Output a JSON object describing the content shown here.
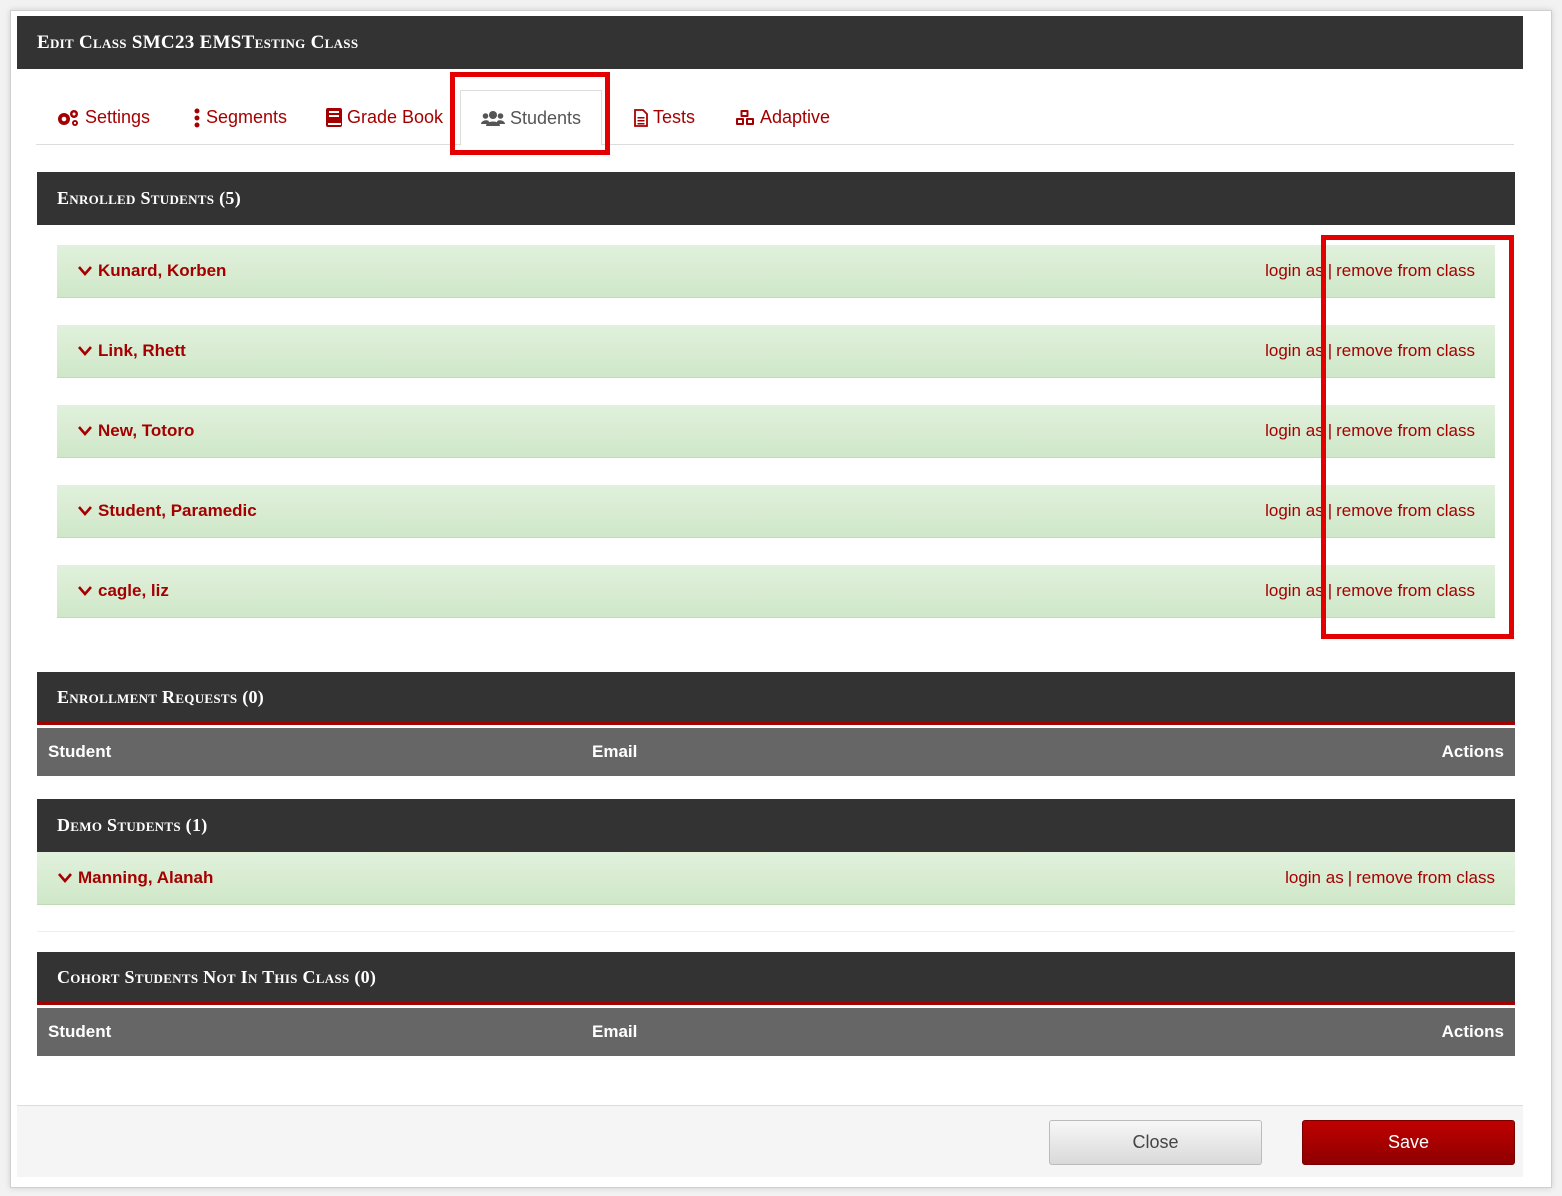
{
  "modal": {
    "title": "Edit Class SMC23 EMSTesting Class"
  },
  "tabs": [
    {
      "label": "Settings",
      "icon": "gears-icon"
    },
    {
      "label": "Segments",
      "icon": "vertical-ellipsis-icon"
    },
    {
      "label": "Grade Book",
      "icon": "book-icon"
    },
    {
      "label": "Students",
      "icon": "users-icon",
      "active": true
    },
    {
      "label": "Tests",
      "icon": "document-icon"
    },
    {
      "label": "Adaptive",
      "icon": "cubes-icon"
    }
  ],
  "enrolled": {
    "title": "Enrolled Students (5)",
    "students": [
      {
        "name": "Kunard, Korben"
      },
      {
        "name": "Link, Rhett"
      },
      {
        "name": "New, Totoro"
      },
      {
        "name": "Student, Paramedic"
      },
      {
        "name": "cagle, liz"
      }
    ]
  },
  "actions": {
    "login_as": "login as",
    "separator": "|",
    "remove": "remove from class"
  },
  "requests": {
    "title": "Enrollment Requests (0)",
    "columns": {
      "student": "Student",
      "email": "Email",
      "actions": "Actions"
    }
  },
  "demo": {
    "title": "Demo Students (1)",
    "students": [
      {
        "name": "Manning, Alanah"
      }
    ]
  },
  "cohort": {
    "title": "Cohort Students Not In This Class (0)",
    "columns": {
      "student": "Student",
      "email": "Email",
      "actions": "Actions"
    }
  },
  "footer": {
    "close_label": "Close",
    "save_label": "Save"
  },
  "colors": {
    "accent": "#a50000",
    "header_bg": "#333333",
    "row_green": "#d8edd2",
    "highlight": "#e30000"
  }
}
